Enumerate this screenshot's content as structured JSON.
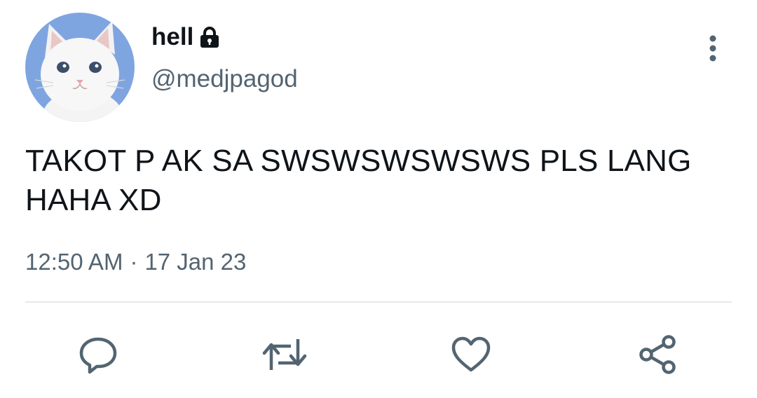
{
  "user": {
    "display_name": "hell",
    "handle": "@medjpagod",
    "protected": true,
    "avatar_icon": "white-cat-avatar",
    "lock_icon": "lock-icon"
  },
  "tweet": {
    "text": "TAKOT P AK SA SWSWSWSWSWS PLS LANG HAHA XD",
    "time": "12:50 AM",
    "separator": "·",
    "date": "17 Jan 23"
  },
  "actions": [
    {
      "icon": "reply-icon"
    },
    {
      "icon": "retweet-icon"
    },
    {
      "icon": "like-icon"
    },
    {
      "icon": "share-icon"
    }
  ],
  "menu": {
    "icon": "more-options-icon"
  },
  "colors": {
    "text_primary": "#0f1419",
    "text_secondary": "#536471",
    "divider": "#e6e9eb",
    "icon": "#536471",
    "avatar_bg": "#7fa5e0"
  }
}
